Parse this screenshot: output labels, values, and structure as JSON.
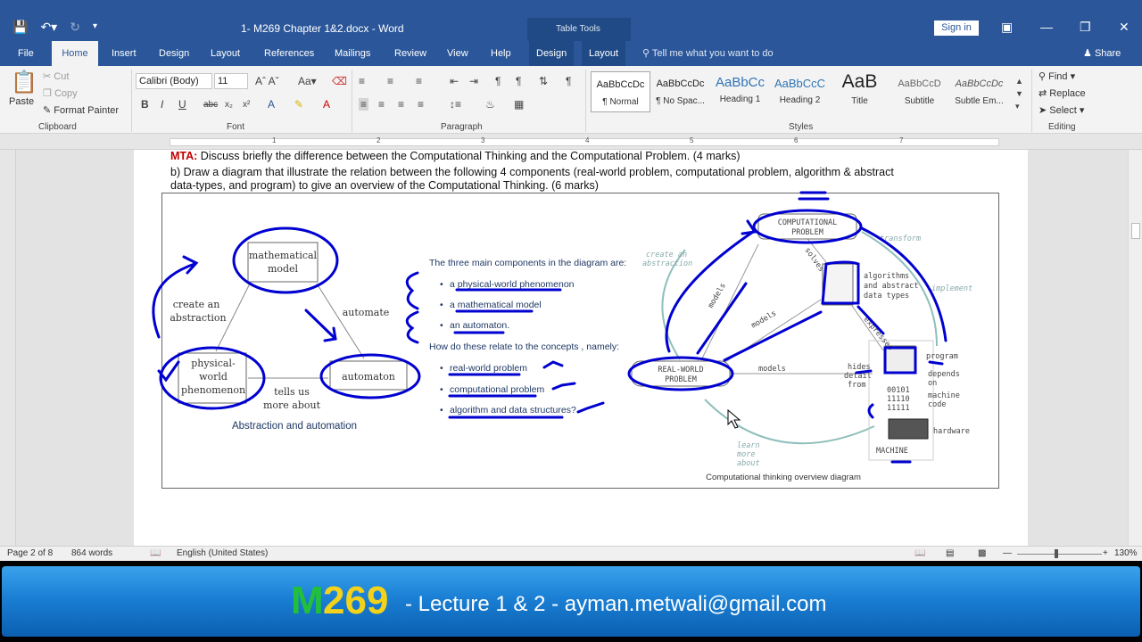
{
  "window": {
    "doc_title": "1- M269 Chapter 1&2.docx - Word",
    "context_tab_group": "Table Tools",
    "sign_in": "Sign in"
  },
  "tabs": [
    "File",
    "Home",
    "Insert",
    "Design",
    "Layout",
    "References",
    "Mailings",
    "Review",
    "View",
    "Help",
    "Design",
    "Layout"
  ],
  "tell_me": "Tell me what you want to do",
  "share": "Share",
  "ribbon": {
    "clipboard": {
      "label": "Clipboard",
      "paste": "Paste",
      "cut": "Cut",
      "copy": "Copy",
      "format_painter": "Format Painter"
    },
    "font": {
      "label": "Font",
      "name": "Calibri (Body)",
      "size": "11"
    },
    "paragraph": {
      "label": "Paragraph"
    },
    "styles": {
      "label": "Styles",
      "items": [
        {
          "sample": "AaBbCcDc",
          "name": "¶ Normal"
        },
        {
          "sample": "AaBbCcDc",
          "name": "¶ No Spac..."
        },
        {
          "sample": "AaBbCc",
          "name": "Heading 1"
        },
        {
          "sample": "AaBbCcC",
          "name": "Heading 2"
        },
        {
          "sample": "AaB",
          "name": "Title"
        },
        {
          "sample": "AaBbCcD",
          "name": "Subtitle"
        },
        {
          "sample": "AaBbCcDc",
          "name": "Subtle Em..."
        }
      ]
    },
    "editing": {
      "label": "Editing",
      "find": "Find",
      "replace": "Replace",
      "select": "Select"
    }
  },
  "ruler_numbers": [
    "1",
    "2",
    "3",
    "4",
    "5",
    "6",
    "7"
  ],
  "document": {
    "q_label": "MTA:",
    "q_a": "Discuss briefly the difference between the Computational Thinking and the Computational Problem. (4 marks)",
    "q_b_line1": "b) Draw a diagram that illustrate the relation between the following 4 components (real-world problem, computational problem, algorithm & abstract",
    "q_b_line2": "data-types, and program) to give an overview of the Computational Thinking. (6 marks)",
    "left_diagram": {
      "node_math": [
        "mathematical",
        "model"
      ],
      "node_phys": [
        "physical-",
        "world",
        "phenomenon"
      ],
      "node_auto": "automaton",
      "lbl_abstraction": [
        "create an",
        "abstraction"
      ],
      "lbl_automate": "automate",
      "lbl_tells": [
        "tells us",
        "more about"
      ],
      "caption": "Abstraction and automation"
    },
    "middle": {
      "heading1": "The three main components in the diagram are:",
      "items1": [
        "a physical-world phenomenon",
        "a mathematical model",
        "an automaton."
      ],
      "heading2": "How do these relate to the concepts , namely:",
      "items2": [
        "real-world problem",
        "computational problem",
        "algorithm and data structures?"
      ]
    },
    "right_diagram": {
      "comp_problem": [
        "COMPUTATIONAL",
        "PROBLEM"
      ],
      "real_problem": [
        "REAL-WORLD",
        "PROBLEM"
      ],
      "create_abs": [
        "create an",
        "abstraction"
      ],
      "transform": "transform",
      "solves": "solves",
      "algorithms": [
        "algorithms",
        "and abstract",
        "data types"
      ],
      "implement": "implement",
      "expresses": "expresses",
      "models1": "models",
      "models2": "models",
      "models3": "models",
      "hides": [
        "hides",
        "detail",
        "from"
      ],
      "program": "program",
      "depends": [
        "depends",
        "on",
        "machine",
        "code"
      ],
      "binary": [
        "00101",
        "11110",
        "11111"
      ],
      "hardware": "hardware",
      "machine": "MACHINE",
      "learn": [
        "learn",
        "more",
        "about"
      ],
      "caption": "Computational thinking overview diagram"
    }
  },
  "status": {
    "page": "Page 2 of 8",
    "words": "864 words",
    "language": "English (United States)",
    "zoom": "130%"
  },
  "banner": {
    "m": "M",
    "num": "269",
    "rest": "- Lecture 1 & 2 - ayman.metwali@gmail.com"
  },
  "colors": {
    "word_blue": "#2b579a",
    "ink_blue": "#0000d0",
    "banner_green": "#22c03a",
    "banner_yellow": "#f2d21a",
    "mta_red": "#c00000"
  }
}
